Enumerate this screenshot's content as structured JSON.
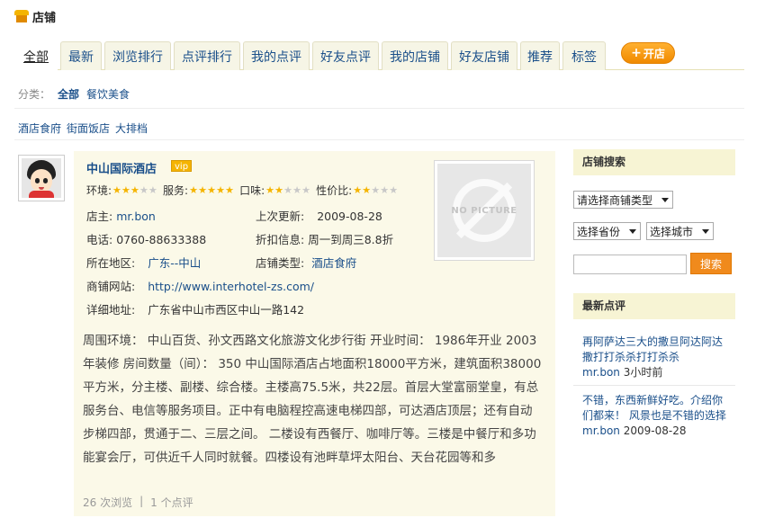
{
  "page": {
    "title": "店铺"
  },
  "tabs": [
    {
      "label": "全部",
      "active": true
    },
    {
      "label": "最新"
    },
    {
      "label": "浏览排行"
    },
    {
      "label": "点评排行"
    },
    {
      "label": "我的点评"
    },
    {
      "label": "好友点评"
    },
    {
      "label": "我的店铺"
    },
    {
      "label": "好友店铺"
    },
    {
      "label": "推荐"
    },
    {
      "label": "标签"
    }
  ],
  "open_store_button": "开店",
  "category": {
    "label": "分类：",
    "items": [
      "全部",
      "餐饮美食"
    ]
  },
  "subcategories": [
    "酒店食府",
    "街面饭店",
    "大排档"
  ],
  "store": {
    "name": "中山国际酒店",
    "badge": "vip",
    "ratings": [
      {
        "label": "环境:",
        "stars": 3
      },
      {
        "label": "服务:",
        "stars": 5
      },
      {
        "label": "口味:",
        "stars": 2
      },
      {
        "label": "性价比:",
        "stars": 2
      }
    ],
    "owner_label": "店主:",
    "owner": "mr.bon",
    "updated_label": "上次更新:",
    "updated": "2009-08-28",
    "phone_label": "电话:",
    "phone": "0760-88633388",
    "discount_label": "折扣信息:",
    "discount": "周一到周三8.8折",
    "region_label": "所在地区:",
    "region": "广东--中山",
    "type_label": "店铺类型:",
    "type": "酒店食府",
    "website_label": "商铺网站:",
    "website": "http://www.interhotel-zs.com/",
    "address_label": "详细地址:",
    "address": "广东省中山市西区中山一路142",
    "picture_label": "NO PICTURE",
    "description": "周围环境： 中山百货、孙文西路文化旅游文化步行街 开业时间： 1986年开业 2003年装修 房间数量（间）： 350 中山国际酒店占地面积18000平方米，建筑面积38000平方米，分主楼、副楼、综合楼。主楼高75.5米，共22层。首层大堂富丽堂皇，有总服务台、电信等服务项目。正中有电脑程控高速电梯四部，可达酒店顶层；还有自动步梯四部，贯通于二、三层之间。 二楼设有西餐厅、咖啡厅等。三楼是中餐厅和多功能宴会厅，可供近千人同时就餐。四楼设有池畔草坪太阳台、天台花园等和多",
    "views": "26 次浏览",
    "reviews": "1 个点评"
  },
  "sidebar": {
    "search_title": "店铺搜索",
    "type_select": "请选择商铺类型",
    "province_select": "选择省份",
    "city_select": "选择城市",
    "search_button": "搜索",
    "latest_title": "最新点评",
    "reviews": [
      {
        "text": "再阿萨达三大的撒旦阿达阿达撒打打杀杀打打杀杀",
        "user": "mr.bon",
        "time": "3小时前"
      },
      {
        "text": "不错，东西新鲜好吃。介绍你们都来！ 风景也是不错的选择",
        "user": "mr.bon",
        "time": "2009-08-28"
      }
    ]
  },
  "colors": {
    "link": "#1a4f8a",
    "accent": "#f08a1c",
    "card_bg": "#fbf9e8",
    "star": "#f5b400"
  }
}
